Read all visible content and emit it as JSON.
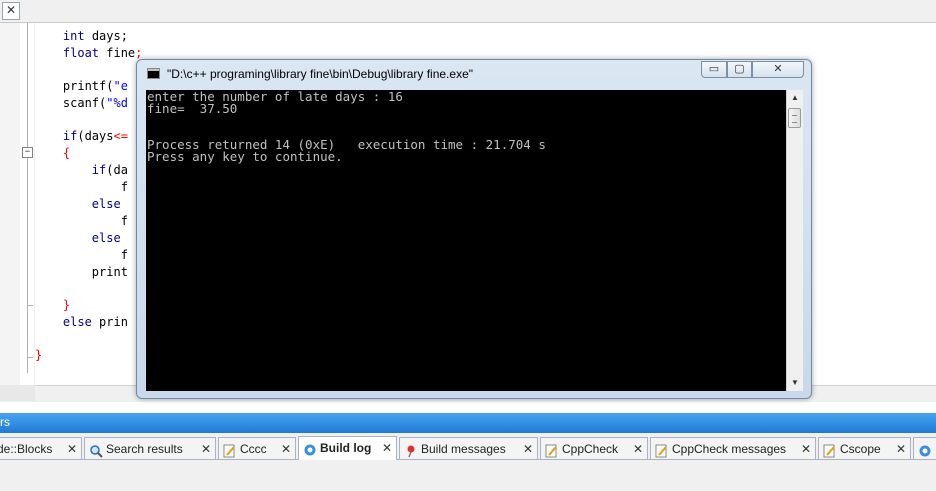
{
  "editor": {
    "lines": [
      {
        "id": "l1",
        "parts": [
          {
            "t": "    ",
            "c": "fn"
          },
          {
            "t": "int",
            "c": "kw"
          },
          {
            "t": " days;",
            "c": "fn"
          }
        ]
      },
      {
        "id": "l2",
        "parts": [
          {
            "t": "    ",
            "c": "fn"
          },
          {
            "t": "float",
            "c": "kw"
          },
          {
            "t": " fine",
            "c": "fn"
          },
          {
            "t": ";",
            "c": "op"
          }
        ]
      },
      {
        "id": "l3",
        "parts": [
          {
            "t": "    printf(",
            "c": "fn"
          },
          {
            "t": "\"e",
            "c": "str"
          }
        ]
      },
      {
        "id": "l4",
        "parts": [
          {
            "t": "    scanf(",
            "c": "fn"
          },
          {
            "t": "\"%d",
            "c": "str"
          }
        ]
      },
      {
        "id": "l5",
        "parts": [
          {
            "t": "    ",
            "c": "fn"
          },
          {
            "t": "if",
            "c": "kw"
          },
          {
            "t": "(days",
            "c": "fn"
          },
          {
            "t": "<=",
            "c": "op"
          }
        ]
      },
      {
        "id": "l6",
        "parts": [
          {
            "t": "    ",
            "c": "fn"
          },
          {
            "t": "{",
            "c": "br"
          }
        ]
      },
      {
        "id": "l7",
        "parts": [
          {
            "t": "        ",
            "c": "fn"
          },
          {
            "t": "if",
            "c": "kw"
          },
          {
            "t": "(da",
            "c": "fn"
          }
        ]
      },
      {
        "id": "l8",
        "parts": [
          {
            "t": "            f",
            "c": "fn"
          }
        ]
      },
      {
        "id": "l9",
        "parts": [
          {
            "t": "        ",
            "c": "fn"
          },
          {
            "t": "else",
            "c": "kw"
          }
        ]
      },
      {
        "id": "l10",
        "parts": [
          {
            "t": "            f",
            "c": "fn"
          }
        ]
      },
      {
        "id": "l11",
        "parts": [
          {
            "t": "        ",
            "c": "fn"
          },
          {
            "t": "else",
            "c": "kw"
          }
        ]
      },
      {
        "id": "l12",
        "parts": [
          {
            "t": "            f",
            "c": "fn"
          }
        ]
      },
      {
        "id": "l13",
        "parts": [
          {
            "t": "        print",
            "c": "fn"
          }
        ]
      },
      {
        "id": "l14",
        "parts": [
          {
            "t": "    ",
            "c": "fn"
          },
          {
            "t": "}",
            "c": "br"
          }
        ]
      },
      {
        "id": "l15",
        "parts": [
          {
            "t": "    ",
            "c": "fn"
          },
          {
            "t": "else",
            "c": "kw"
          },
          {
            "t": " prin",
            "c": "fn"
          }
        ]
      },
      {
        "id": "l16",
        "parts": [
          {
            "t": "}",
            "c": "br"
          }
        ]
      }
    ]
  },
  "top": {
    "close_glyph": "✕"
  },
  "fold": {
    "collapse_glyph": "−"
  },
  "console": {
    "title": "\"D:\\c++ programing\\library fine\\bin\\Debug\\library fine.exe\"",
    "lines": [
      "enter the number of late days : 16",
      "fine=  37.50",
      "",
      "",
      "Process returned 14 (0xE)   execution time : 21.704 s",
      "Press any key to continue."
    ],
    "buttons": {
      "minimize": "▭",
      "maximize": "▢",
      "close": "✕"
    },
    "scroll": {
      "up": "▲",
      "down": "▼"
    }
  },
  "panel": {
    "header_label": "rs",
    "tabs": [
      {
        "label": "de::Blocks",
        "icon": "none",
        "active": false
      },
      {
        "label": "Search results",
        "icon": "magnifier-icon",
        "active": false
      },
      {
        "label": "Cccc",
        "icon": "pencil-doc-icon",
        "active": false
      },
      {
        "label": "Build log",
        "icon": "gear-build-icon",
        "active": true
      },
      {
        "label": "Build messages",
        "icon": "pin-icon",
        "active": false
      },
      {
        "label": "CppCheck",
        "icon": "pencil-doc-icon",
        "active": false
      },
      {
        "label": "CppCheck messages",
        "icon": "pencil-doc-icon",
        "active": false
      },
      {
        "label": "Cscope",
        "icon": "pencil-doc-icon",
        "active": false
      },
      {
        "label": "",
        "icon": "gear-build-icon",
        "active": false
      }
    ],
    "tab_close_glyph": "✕"
  },
  "colors": {
    "keyword": "#00008b",
    "string": "#0000ff",
    "operator": "#ff0000",
    "console_bg": "#000000",
    "console_fg": "#c0c0c0",
    "panel_header": "#2b8ae0"
  }
}
